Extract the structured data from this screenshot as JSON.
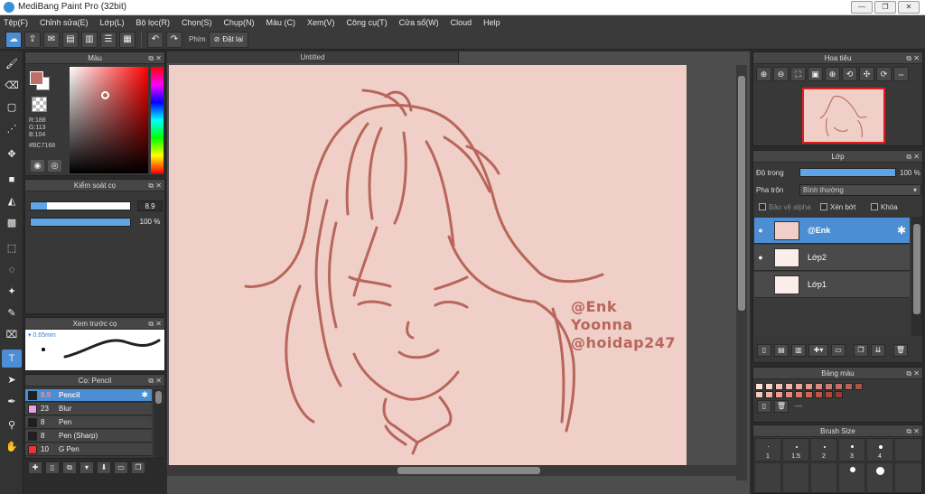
{
  "window": {
    "title": "MediBang Paint Pro (32bit)",
    "minimize": "—",
    "maximize": "❐",
    "close": "✕"
  },
  "menu": [
    "Tệp(F)",
    "Chỉnh sửa(E)",
    "Lớp(L)",
    "Bộ lọc(R)",
    "Chọn(S)",
    "Chụp(N)",
    "Màu (C)",
    "Xem(V)",
    "Công cụ(T)",
    "Cửa sổ(W)",
    "Cloud",
    "Help"
  ],
  "toolbar": {
    "shortcut_label": "Phím",
    "reset_label": "Đặt lại"
  },
  "color_panel": {
    "title": "Màu",
    "r": "R:188",
    "g": "G:113",
    "b": "B:104",
    "hex": "#BC7168",
    "main_color": "#bc7168"
  },
  "brush_control": {
    "title": "Kiểm soát cọ",
    "size_value": "8.9",
    "size_fraction": 0.16,
    "opacity_value": "100 %",
    "opacity_fraction": 1.0
  },
  "brush_preview": {
    "title": "Xem trước cọ",
    "size_label": "0.65mm"
  },
  "brush_list": {
    "title": "Cọ: Pencil",
    "items": [
      {
        "size": "8.9",
        "name": "Pencil",
        "color": "#1f1f1f",
        "selected": true
      },
      {
        "size": "23",
        "name": "Blur",
        "color": "#e8a0e8",
        "selected": false
      },
      {
        "size": "8",
        "name": "Pen",
        "color": "#1f1f1f",
        "selected": false
      },
      {
        "size": "8",
        "name": "Pen (Sharp)",
        "color": "#1f1f1f",
        "selected": false
      },
      {
        "size": "10",
        "name": "G Pen",
        "color": "#ee3333",
        "selected": false
      }
    ]
  },
  "canvas": {
    "tab_title": "Untitled",
    "paper_color": "#efcfc7",
    "line_color": "#b8665c",
    "watermark": [
      "@Enk",
      "Yoonna",
      "@hoidap247"
    ]
  },
  "navigator": {
    "title": "Hoa tiêu"
  },
  "layers": {
    "title": "Lớp",
    "opacity_label": "Độ trong",
    "opacity_value": "100 %",
    "blend_label": "Pha trộn",
    "blend_value": "Bình thường",
    "protect_alpha": "Bảo vệ alpha",
    "clipping": "Xén bớt",
    "lock": "Khóa",
    "items": [
      {
        "name": "@Enk",
        "selected": true,
        "visible": true
      },
      {
        "name": "Lớp2",
        "selected": false,
        "visible": true
      },
      {
        "name": "Lớp1",
        "selected": false,
        "visible": false
      }
    ]
  },
  "palette": {
    "title": "Bảng màu",
    "none_label": "---",
    "swatches": [
      "#fbe3dc",
      "#f7d4cb",
      "#f2c4b9",
      "#efb7aa",
      "#e9a898",
      "#e29a8b",
      "#d98a7d",
      "#cf7a6e",
      "#c56d62",
      "#b85f56",
      "#a9524a",
      "#f7cac0",
      "#f5b3a6",
      "#ee9e8e",
      "#e68a78",
      "#de7663",
      "#d56351",
      "#c45344",
      "#b04538",
      "#9b3a30"
    ]
  },
  "brush_size": {
    "title": "Brush Size",
    "row1": [
      "1",
      "1.5",
      "2",
      "3",
      "4"
    ]
  }
}
